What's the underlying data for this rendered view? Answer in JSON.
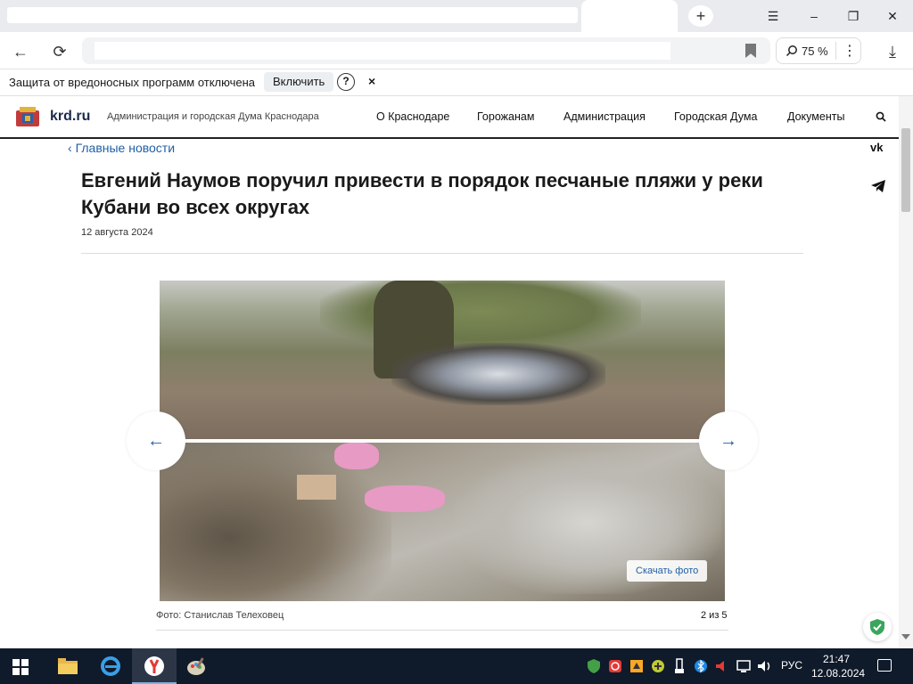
{
  "browser": {
    "zoom": "75 %"
  },
  "infobar": {
    "message": "Защита от вредоносных программ отключена",
    "enable_label": "Включить",
    "help_label": "?",
    "close_label": "×"
  },
  "site": {
    "logo_text": "krd.ru",
    "description": "Администрация и городская Дума Краснодара",
    "nav": [
      "О Краснодаре",
      "Горожанам",
      "Администрация",
      "Городская Дума",
      "Документы"
    ]
  },
  "article": {
    "back_link": "Главные новости",
    "title": "Евгений Наумов поручил привести в порядок песчаные пляжи у реки Кубани во всех округах",
    "date": "12 августа 2024",
    "share_vk": "vk"
  },
  "gallery": {
    "download_label": "Скачать фото",
    "caption": "Фото: Станислав Телеховец",
    "counter": "2 из 5",
    "prev_arrow": "←",
    "next_arrow": "→"
  },
  "taskbar": {
    "lang": "РУС",
    "time": "21:47",
    "date": "12.08.2024"
  },
  "colors": {
    "accent": "#1f5fa6",
    "taskbar": "#0f1a2a"
  }
}
